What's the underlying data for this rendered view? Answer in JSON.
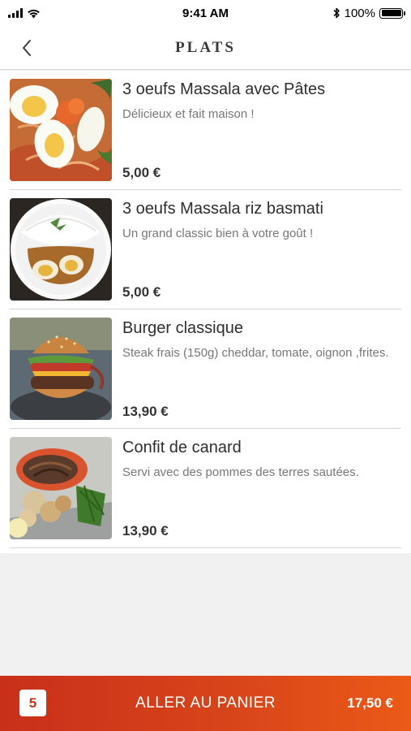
{
  "status_bar": {
    "time": "9:41 AM",
    "battery_percent": "100%",
    "icons": [
      "signal-icon",
      "wifi-icon",
      "bluetooth-icon",
      "battery-icon"
    ]
  },
  "header": {
    "title": "PLATS",
    "back_icon": "chevron-left-icon"
  },
  "dishes": [
    {
      "name": "3 oeufs Massala avec Pâtes",
      "description": "Délicieux et fait maison !",
      "price": "5,00 €"
    },
    {
      "name": "3 oeufs Massala riz basmati",
      "description": "Un grand classic bien à votre goût !",
      "price": "5,00 €"
    },
    {
      "name": "Burger classique",
      "description": "Steak frais (150g) cheddar, tomate, oignon ,frites.",
      "price": "13,90 €"
    },
    {
      "name": "Confit de canard",
      "description": "Servi avec des pommes des terres sautées.",
      "price": "13,90 €"
    }
  ],
  "cart": {
    "count": "5",
    "label": "ALLER AU PANIER",
    "total": "17,50 €"
  },
  "colors": {
    "accent": "#c8301a",
    "accent_end": "#ec5a17",
    "background": "#f1f1f1"
  }
}
